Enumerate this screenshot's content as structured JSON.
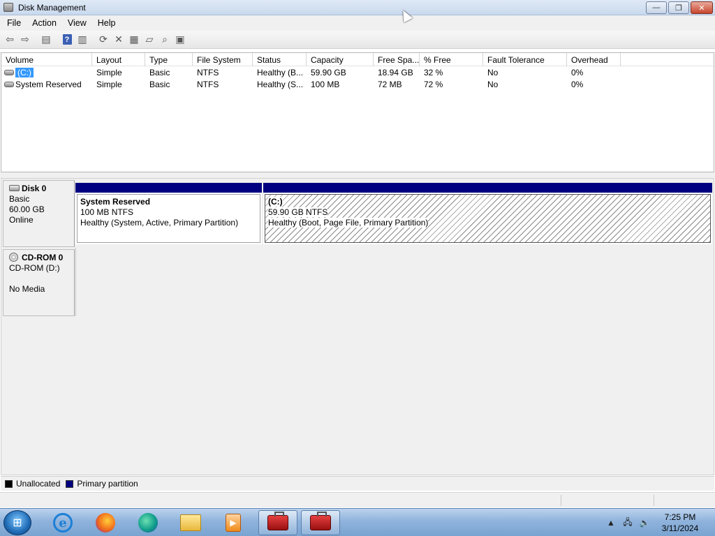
{
  "window": {
    "title": "Disk Management",
    "controls": {
      "minimize": "—",
      "maximize": "❐",
      "close": "✕"
    }
  },
  "menu": [
    "File",
    "Action",
    "View",
    "Help"
  ],
  "toolbar": {
    "icons": [
      "back-icon",
      "forward-icon",
      "console-tree-icon",
      "help-icon",
      "action-pane-icon",
      "refresh-icon",
      "delete-icon",
      "properties-icon",
      "open-icon",
      "search-icon",
      "rescan-disks-icon"
    ],
    "help_glyph": "?"
  },
  "volume_list": {
    "columns": [
      "Volume",
      "Layout",
      "Type",
      "File System",
      "Status",
      "Capacity",
      "Free Spa...",
      "% Free",
      "Fault Tolerance",
      "Overhead"
    ],
    "rows": [
      {
        "volume": "(C:)",
        "layout": "Simple",
        "type": "Basic",
        "fs": "NTFS",
        "status": "Healthy (B...",
        "capacity": "59.90 GB",
        "free": "18.94 GB",
        "pct_free": "32 %",
        "fault": "No",
        "overhead": "0%",
        "selected": true
      },
      {
        "volume": "System Reserved",
        "layout": "Simple",
        "type": "Basic",
        "fs": "NTFS",
        "status": "Healthy (S...",
        "capacity": "100 MB",
        "free": "72 MB",
        "pct_free": "72 %",
        "fault": "No",
        "overhead": "0%",
        "selected": false
      }
    ]
  },
  "disks": [
    {
      "name": "Disk 0",
      "type": "Basic",
      "size": "60.00 GB",
      "state": "Online",
      "partitions": [
        {
          "title": "System Reserved",
          "size": "100 MB NTFS",
          "status": "Healthy (System, Active, Primary Partition)"
        },
        {
          "title": "(C:)",
          "size": "59.90 GB NTFS",
          "status": "Healthy (Boot, Page File, Primary Partition)"
        }
      ]
    },
    {
      "name": "CD-ROM 0",
      "drive": "CD-ROM (D:)",
      "media": "No Media"
    }
  ],
  "legend": [
    {
      "label": "Unallocated",
      "color": "#000000"
    },
    {
      "label": "Primary partition",
      "color": "#000080"
    }
  ],
  "taskbar": {
    "start_glyph": "⊞",
    "apps": [
      "internet-explorer-icon",
      "firefox-icon",
      "edge-icon",
      "file-explorer-icon",
      "media-player-icon",
      "toolbox-icon",
      "toolbox-icon"
    ],
    "ie_glyph": "e",
    "media_glyph": "▶",
    "tray": {
      "arrow": "▲",
      "network": "🖧",
      "volume": "🔈"
    },
    "clock_time": "7:25 PM",
    "clock_date": "3/11/2024"
  }
}
